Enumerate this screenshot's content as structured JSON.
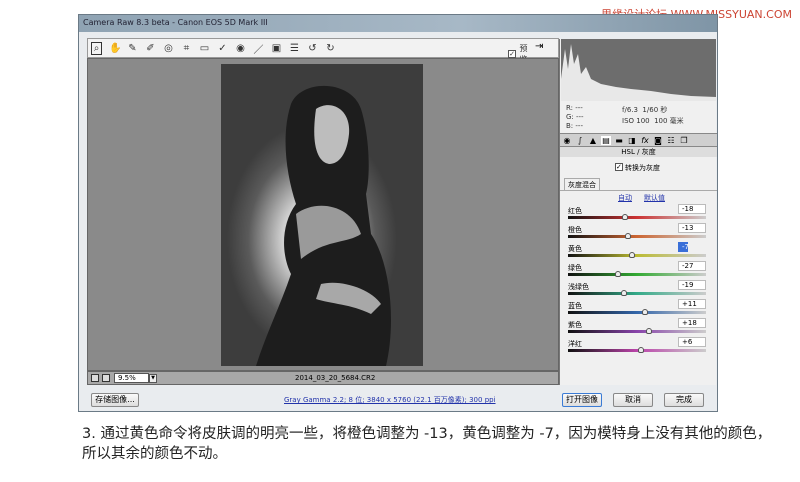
{
  "watermark": "思缘设计论坛 WWW.MISSYUAN.COM",
  "window": {
    "title": "Camera Raw 8.3 beta -  Canon EOS 5D Mark III"
  },
  "toolbar": {
    "icons": [
      "zoom-icon",
      "hand-icon",
      "white-balance-icon",
      "color-sampler-icon",
      "target-adjust-icon",
      "crop-icon",
      "straighten-icon",
      "spot-removal-icon",
      "red-eye-icon",
      "adjustment-brush-icon",
      "graduated-filter-icon",
      "list-icon",
      "rotate-left-icon",
      "rotate-right-icon"
    ],
    "preview_label": "预览",
    "preview_checked": true
  },
  "readout": {
    "r": "R:  ---",
    "g": "G:  ---",
    "b": "B:  ---",
    "aperture": "f/6.3",
    "shutter": "1/60 秒",
    "iso": "ISO 100",
    "focal": "100 毫米"
  },
  "panel": {
    "section_title": "HSL / 灰度",
    "convert_label": "转换为灰度",
    "convert_checked": true,
    "tab_label": "灰度混合",
    "auto_link": "自动",
    "default_link": "默认值",
    "sliders": [
      {
        "label": "红色",
        "value": "-18",
        "num": -18,
        "colors": [
          "#111",
          "#c33",
          "#ccc"
        ]
      },
      {
        "label": "橙色",
        "value": "-13",
        "num": -13,
        "colors": [
          "#111",
          "#c63",
          "#ccc"
        ]
      },
      {
        "label": "黄色",
        "value": "-7",
        "num": -7,
        "colors": [
          "#111",
          "#bb3",
          "#ccc"
        ],
        "selected": true
      },
      {
        "label": "绿色",
        "value": "-27",
        "num": -27,
        "colors": [
          "#111",
          "#3a3",
          "#ccc"
        ]
      },
      {
        "label": "浅绿色",
        "value": "-19",
        "num": -19,
        "colors": [
          "#111",
          "#3a8",
          "#ccc"
        ]
      },
      {
        "label": "蓝色",
        "value": "+11",
        "num": 11,
        "colors": [
          "#111",
          "#36a",
          "#ccc"
        ]
      },
      {
        "label": "紫色",
        "value": "+18",
        "num": 18,
        "colors": [
          "#111",
          "#84a",
          "#ccc"
        ]
      },
      {
        "label": "洋红",
        "value": "+6",
        "num": 6,
        "colors": [
          "#111",
          "#b4a",
          "#ccc"
        ]
      }
    ]
  },
  "bottom": {
    "zoom": "9.5%",
    "filename": "2014_03_20_5684.CR2"
  },
  "footer": {
    "save_label": "存储图像...",
    "workflow_link": "Gray Gamma 2.2; 8 位; 3840 x 5760 (22.1 百万像素); 300 ppi",
    "open_label": "打开图像",
    "cancel_label": "取消",
    "done_label": "完成"
  },
  "caption": "3. 通过黄色命令将皮肤调的明亮一些，将橙色调整为 -13，黄色调整为 -7，因为模特身上没有其他的颜色，所以其余的颜色不动。"
}
